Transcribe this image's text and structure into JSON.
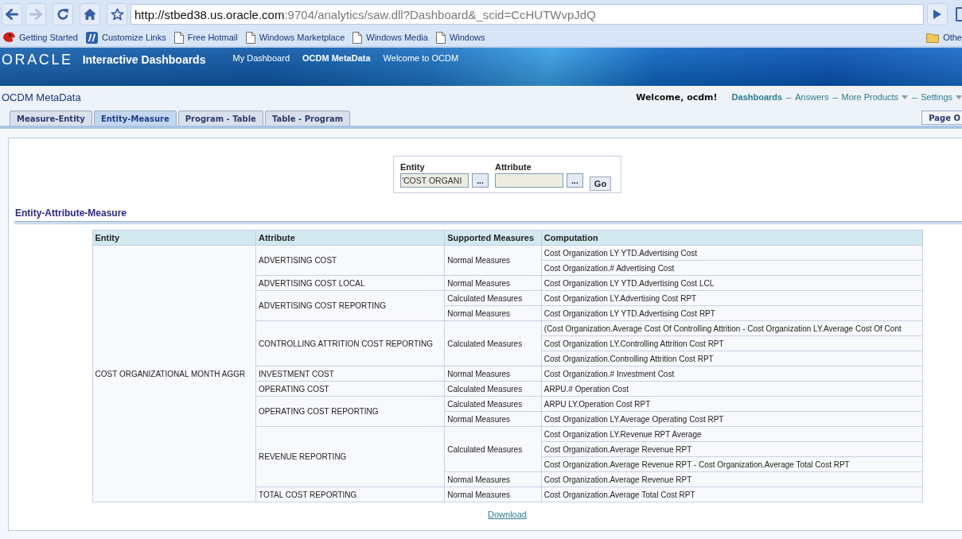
{
  "browser": {
    "nav_buttons": [
      {
        "kind": "back",
        "disabled": false
      },
      {
        "kind": "forward",
        "disabled": true
      },
      {
        "kind": "reload",
        "disabled": false
      },
      {
        "kind": "home",
        "disabled": false
      }
    ],
    "address": {
      "host": "http://stbed38.us.oracle.com",
      "path": ":9704/analytics/saw.dll?Dashboard&_scid=CcHUTWvpJdQ"
    },
    "bookmarks": [
      {
        "label": "Getting Started",
        "kind": "logo"
      },
      {
        "label": "Customize Links",
        "kind": "tile"
      },
      {
        "label": "Free Hotmail",
        "kind": "page"
      },
      {
        "label": "Windows Marketplace",
        "kind": "page"
      },
      {
        "label": "Windows Media",
        "kind": "page"
      },
      {
        "label": "Windows",
        "kind": "page"
      }
    ],
    "other_bookmarks": "Othe"
  },
  "header": {
    "logo": "ORACLE",
    "product": "Interactive Dashboards",
    "nav": [
      {
        "label": "My Dashboard",
        "selected": false
      },
      {
        "label": "OCDM MetaData",
        "selected": true
      },
      {
        "label": "Welcome to OCDM",
        "selected": false
      }
    ]
  },
  "dashboard": {
    "title": "OCDM MetaData",
    "welcome": "Welcome, ocdm!",
    "links": [
      {
        "label": "Dashboards",
        "selected": true,
        "menu": false
      },
      {
        "separator": "–",
        "label": "Answers",
        "selected": false,
        "menu": false
      },
      {
        "separator": "–",
        "label": "More Products",
        "selected": false,
        "menu": true
      },
      {
        "separator": "–",
        "label": "Settings",
        "selected": false,
        "menu": true
      }
    ],
    "tabs": [
      {
        "label": "Measure-Entity",
        "selected": false
      },
      {
        "label": "Entity-Measure",
        "selected": true
      },
      {
        "label": "Program - Table",
        "selected": false
      },
      {
        "label": "Table - Program",
        "selected": false
      }
    ],
    "page_options": "Page O"
  },
  "prompt": {
    "fields": [
      {
        "label": "Entity",
        "value": "'COST ORGANI",
        "browse": "..."
      },
      {
        "label": "Attribute",
        "browse": "..."
      }
    ],
    "go": "Go"
  },
  "section": {
    "title": "Entity-Attribute-Measure",
    "table": {
      "columns": [
        "Entity",
        "Attribute",
        "Supported Measures",
        "Computation"
      ],
      "rows": [
        {
          "entity": "COST ORGANIZATIONAL MONTH AGGR",
          "attributes": [
            {
              "attribute": "ADVERTISING COST",
              "measures": [
                {
                  "measure": "Normal Measures",
                  "computations": [
                    "Cost Organization LY YTD.Advertising Cost",
                    "Cost Organization.# Advertising Cost"
                  ]
                }
              ]
            },
            {
              "attribute": "ADVERTISING COST LOCAL",
              "measures": [
                {
                  "measure": "Normal Measures",
                  "computations": [
                    "Cost Organization LY YTD.Advertising Cost LCL"
                  ]
                }
              ]
            },
            {
              "attribute": "ADVERTISING COST REPORTING",
              "measures": [
                {
                  "measure": "Calculated Measures",
                  "computations": [
                    "Cost Organization LY.Advertising Cost RPT"
                  ]
                },
                {
                  "measure": "Normal Measures",
                  "computations": [
                    "Cost Organization LY YTD.Advertising Cost RPT"
                  ]
                }
              ]
            },
            {
              "attribute": "CONTROLLING ATTRITION COST REPORTING",
              "measures": [
                {
                  "measure": "Calculated Measures",
                  "computations": [
                    "(Cost Organization.Average Cost Of Controlling Attrition - Cost Organization LY.Average Cost Of Cont",
                    "Cost Organization LY.Controlling Attrition Cost RPT",
                    "Cost Organization.Controlling Attrition Cost RPT"
                  ]
                }
              ]
            },
            {
              "attribute": "INVESTMENT COST",
              "measures": [
                {
                  "measure": "Normal Measures",
                  "computations": [
                    "Cost Organization.# Investment Cost"
                  ]
                }
              ]
            },
            {
              "attribute": "OPERATING COST",
              "measures": [
                {
                  "measure": "Calculated Measures",
                  "computations": [
                    "ARPU.# Operation Cost"
                  ]
                }
              ]
            },
            {
              "attribute": "OPERATING COST REPORTING",
              "measures": [
                {
                  "measure": "Calculated Measures",
                  "computations": [
                    "ARPU LY.Operation Cost RPT"
                  ]
                },
                {
                  "measure": "Normal Measures",
                  "computations": [
                    "Cost Organization LY.Average Operating Cost RPT"
                  ]
                }
              ]
            },
            {
              "attribute": "REVENUE REPORTING",
              "measures": [
                {
                  "measure": "Calculated Measures",
                  "computations": [
                    "Cost Organization LY.Revenue RPT Average",
                    "Cost Organization.Average Revenue RPT",
                    "Cost Organization.Average Revenue RPT - Cost Organization.Average Total Cost RPT"
                  ]
                },
                {
                  "measure": "Normal Measures",
                  "computations": [
                    "Cost Organization.Average Revenue RPT"
                  ]
                }
              ]
            },
            {
              "attribute": "TOTAL COST REPORTING",
              "measures": [
                {
                  "measure": "Normal Measures",
                  "computations": [
                    "Cost Organization.Average Total Cost RPT"
                  ]
                }
              ]
            }
          ]
        }
      ]
    },
    "download": "Download"
  }
}
